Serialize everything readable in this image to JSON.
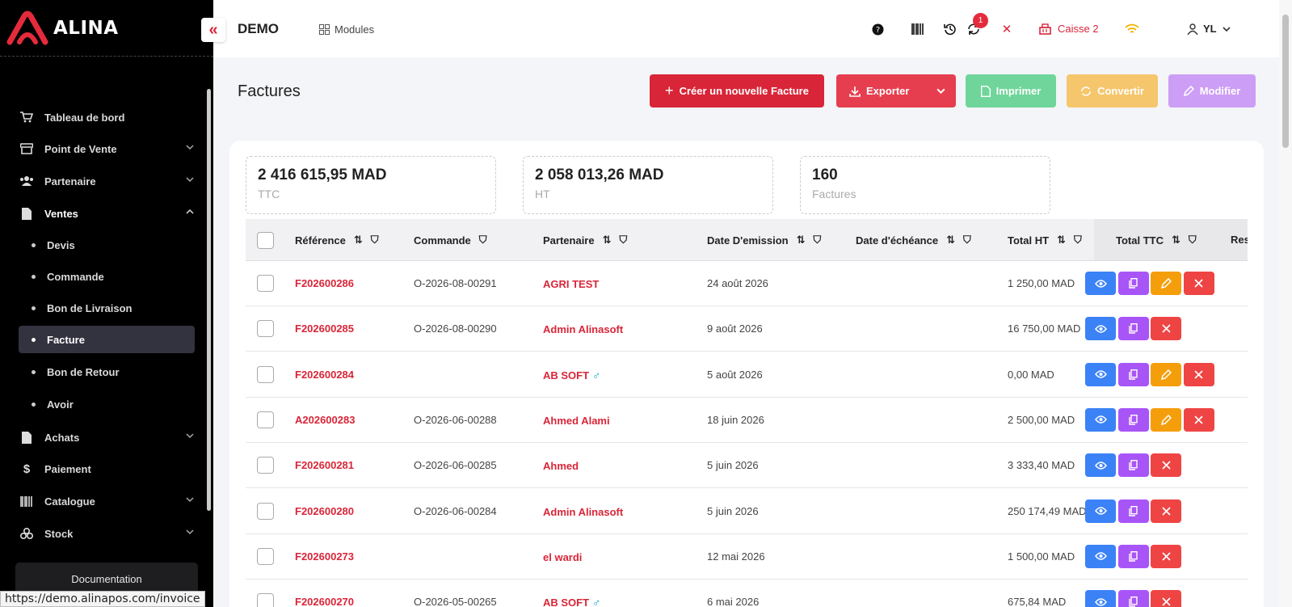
{
  "brand": {
    "name": "ALINA",
    "color": "#d92538"
  },
  "sidebar": {
    "collapse_icon": "«",
    "items": [
      {
        "label": "Tableau de bord",
        "icon": "cart-icon",
        "expandable": false
      },
      {
        "label": "Point de Vente",
        "icon": "store-icon",
        "expandable": true
      },
      {
        "label": "Partenaire",
        "icon": "users-icon",
        "expandable": true
      },
      {
        "label": "Ventes",
        "icon": "file-icon",
        "expandable": true,
        "open": true
      }
    ],
    "ventes_sub": [
      {
        "label": "Devis"
      },
      {
        "label": "Commande"
      },
      {
        "label": "Bon de Livraison"
      },
      {
        "label": "Facture",
        "active": true
      },
      {
        "label": "Bon de Retour"
      },
      {
        "label": "Avoir"
      }
    ],
    "items_after": [
      {
        "label": "Achats",
        "icon": "file-icon",
        "expandable": true
      },
      {
        "label": "Paiement",
        "icon": "dollar-icon",
        "expandable": false
      },
      {
        "label": "Catalogue",
        "icon": "barcode-icon",
        "expandable": true
      },
      {
        "label": "Stock",
        "icon": "boxes-icon",
        "expandable": true
      }
    ],
    "documentation": "Documentation"
  },
  "topbar": {
    "company": "DEMO",
    "modules": "Modules",
    "notif_count": "1",
    "caisse": "Caisse 2",
    "user": "YL"
  },
  "page": {
    "title": "Factures"
  },
  "actions": {
    "create": "Créer un nouvelle Facture",
    "export": "Exporter",
    "print": "Imprimer",
    "convert": "Convertir",
    "edit": "Modifier"
  },
  "stats": [
    {
      "value": "2 416 615,95 MAD",
      "label": "TTC"
    },
    {
      "value": "2 058 013,26 MAD",
      "label": "HT"
    },
    {
      "value": "160",
      "label": "Factures"
    }
  ],
  "table": {
    "columns": {
      "ref": "Référence",
      "order": "Commande",
      "partner": "Partenaire",
      "emit": "Date D'emission",
      "due": "Date d'échéance",
      "ht": "Total HT",
      "ttc": "Total TTC",
      "rest": "Res"
    },
    "rows": [
      {
        "ref": "F202600286",
        "order": "O-2026-08-00291",
        "partner": "AGRI TEST",
        "gender": "",
        "emit": "24 août 2026",
        "ht": "1 250,00 MAD",
        "edit": true
      },
      {
        "ref": "F202600285",
        "order": "O-2026-08-00290",
        "partner": "Admin Alinasoft",
        "gender": "",
        "emit": "9 août 2026",
        "ht": "16 750,00 MAD",
        "edit": false
      },
      {
        "ref": "F202600284",
        "order": "",
        "partner": "AB SOFT",
        "gender": "♂",
        "emit": "5 août 2026",
        "ht": "0,00 MAD",
        "edit": true
      },
      {
        "ref": "A202600283",
        "order": "O-2026-06-00288",
        "partner": "Ahmed Alami",
        "gender": "",
        "emit": "18 juin 2026",
        "ht": "2 500,00 MAD",
        "edit": true
      },
      {
        "ref": "F202600281",
        "order": "O-2026-06-00285",
        "partner": "Ahmed",
        "gender": "",
        "emit": "5 juin 2026",
        "ht": "3 333,40 MAD",
        "edit": false
      },
      {
        "ref": "F202600280",
        "order": "O-2026-06-00284",
        "partner": "Admin Alinasoft",
        "gender": "",
        "emit": "5 juin 2026",
        "ht": "250 174,49 MAD",
        "edit": false
      },
      {
        "ref": "F202600273",
        "order": "",
        "partner": "el wardi",
        "gender": "",
        "emit": "12 mai 2026",
        "ht": "1 500,00 MAD",
        "edit": false
      },
      {
        "ref": "F202600270",
        "order": "O-2026-05-00265",
        "partner": "AB SOFT",
        "gender": "♂",
        "emit": "6 mai 2026",
        "ht": "675,84 MAD",
        "edit": false
      }
    ]
  },
  "status_url": "https://demo.alinapos.com/invoice"
}
